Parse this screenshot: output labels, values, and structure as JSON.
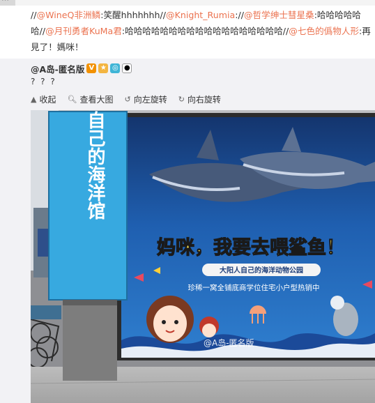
{
  "top_strip_text": "…",
  "repost": {
    "segments": [
      {
        "text": "//",
        "link": false
      },
      {
        "text": "@WineQ非洲鳞",
        "link": true
      },
      {
        "text": ":笑醒hhhhhhh//",
        "link": false
      },
      {
        "text": "@Knight_Rumia",
        "link": true
      },
      {
        "text": "://",
        "link": false
      },
      {
        "text": "@哲学绅士彗星桑",
        "link": true
      },
      {
        "text": ":哈哈哈哈哈哈//",
        "link": false
      },
      {
        "text": "@月刊勇者KuMa君",
        "link": true
      },
      {
        "text": ":哈哈哈哈哈哈哈哈哈哈哈哈哈哈哈哈哈哈//",
        "link": false
      },
      {
        "text": "@七色的僞物人形",
        "link": true
      },
      {
        "text": ":再見了！媽咪！",
        "link": false
      }
    ]
  },
  "original": {
    "author": "@A岛-匿名版",
    "badges": [
      "V",
      "★",
      "◎",
      "●"
    ],
    "text": "? ? ?"
  },
  "toolbar": {
    "collapse": "收起",
    "view_large": "查看大图",
    "rotate_left": "向左旋转",
    "rotate_right": "向右旋转",
    "icons": [
      "collapse-icon",
      "magnify-icon",
      "rotate-left-icon",
      "rotate-right-icon"
    ]
  },
  "photo": {
    "pillar_text": "大阳人自己的海洋馆",
    "headline": "妈咪，我要去喂鲨鱼！",
    "ribbon": "大阳人自己的海洋动物公园",
    "subline": "珍稀一窝全铺底商学位住宅小户型热销中",
    "watermark": "@A岛-匿名版",
    "colors": {
      "sea": "#1f5fb0",
      "deep": "#14356e",
      "pillar": "#37a9e0",
      "headline": "#ffe44d"
    }
  }
}
